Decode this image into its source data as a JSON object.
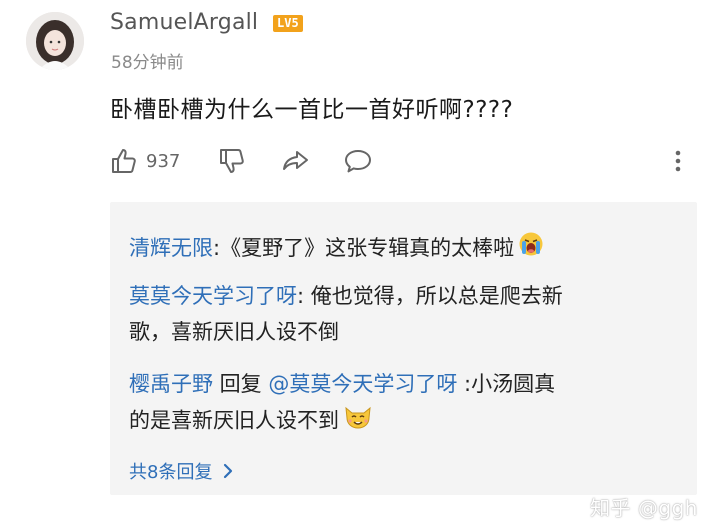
{
  "comment": {
    "username": "SamuelArgall",
    "level_badge": "LV5",
    "time": "58分钟前",
    "text": "卧槽卧槽为什么一首比一首好听啊????",
    "like_count": "937"
  },
  "replies": [
    {
      "author": "清辉无限",
      "separator": ":",
      "text": "《夏野了》这张专辑真的太棒啦",
      "emoji": "crying-emoji"
    },
    {
      "author": "莫莫今天学习了呀",
      "separator": ":",
      "text_line1": " 俺也觉得，所以总是爬去新",
      "text_line2": "歌，喜新厌旧人设不倒"
    },
    {
      "author": "樱禹子野",
      "reply_word": " 回复 ",
      "mention": "@莫莫今天学习了呀",
      "text_line1": " :小汤圆真",
      "text_line2": "的是喜新厌旧人设不到",
      "emoji": "cat-smile-emoji"
    }
  ],
  "more_replies_label": "共8条回复",
  "watermark": "知乎 @ggh",
  "colors": {
    "link_blue": "#2f6fb8",
    "badge_orange": "#f2a21b",
    "reply_bg": "#f4f4f4"
  }
}
